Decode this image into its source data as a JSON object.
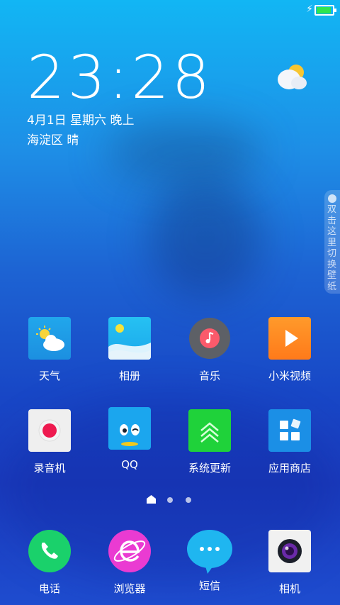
{
  "status_bar": {
    "battery_level": 1.0,
    "battery_color": "#2ee54f",
    "charging_icon": "bolt-icon"
  },
  "lockscreen": {
    "time": "23:28",
    "date": "4月1日 星期六 晚上",
    "location_weather": "海淀区 晴",
    "weather_icon": "partly-cloudy-icon"
  },
  "side_tab": {
    "text": "双击这里切换壁纸",
    "icon": "check-circle-icon"
  },
  "apps_row1": [
    {
      "label": "天气",
      "icon": "weather-icon"
    },
    {
      "label": "相册",
      "icon": "gallery-icon"
    },
    {
      "label": "音乐",
      "icon": "music-icon"
    },
    {
      "label": "小米视频",
      "icon": "video-icon"
    }
  ],
  "apps_row2": [
    {
      "label": "录音机",
      "icon": "recorder-icon"
    },
    {
      "label": "QQ",
      "icon": "qq-icon"
    },
    {
      "label": "系统更新",
      "icon": "update-icon"
    },
    {
      "label": "应用商店",
      "icon": "app-store-icon"
    }
  ],
  "page_indicator": {
    "pages": 3,
    "current": 0
  },
  "dock": [
    {
      "label": "电话",
      "icon": "phone-icon"
    },
    {
      "label": "浏览器",
      "icon": "browser-icon"
    },
    {
      "label": "短信",
      "icon": "messages-icon"
    },
    {
      "label": "相机",
      "icon": "camera-icon"
    }
  ]
}
